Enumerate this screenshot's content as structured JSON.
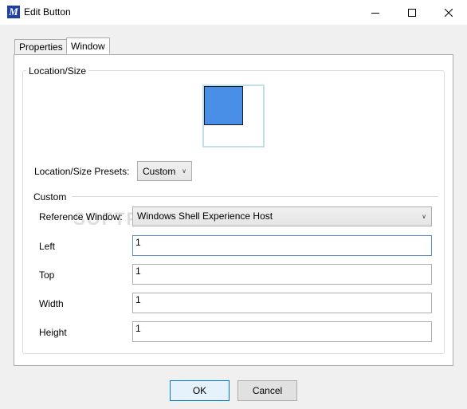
{
  "window": {
    "title": "Edit Button",
    "icon_letter": "M",
    "minimize_icon": "minimize-icon",
    "maximize_icon": "maximize-icon",
    "close_icon": "close-icon"
  },
  "tabs": [
    {
      "label": "Properties",
      "active": false
    },
    {
      "label": "Window",
      "active": true
    }
  ],
  "location_size": {
    "group_label": "Location/Size",
    "presets_label": "Location/Size Presets:",
    "presets_value": "Custom",
    "preview_color": "#4a8fe7"
  },
  "custom": {
    "group_label": "Custom",
    "reference_label": "Reference Window:",
    "reference_value": "Windows Shell Experience Host",
    "left_label": "Left",
    "left_value": "1",
    "top_label": "Top",
    "top_value": "1",
    "width_label": "Width",
    "width_value": "1",
    "height_label": "Height",
    "height_value": "1"
  },
  "buttons": {
    "ok": "OK",
    "cancel": "Cancel"
  },
  "watermark": "SOFTPEDIA"
}
